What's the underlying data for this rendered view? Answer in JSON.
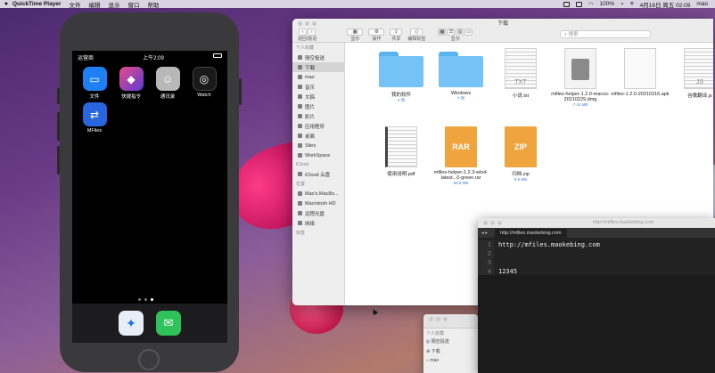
{
  "menubar": {
    "apple": "",
    "app_name": "QuickTime Player",
    "items": [
      "文件",
      "编辑",
      "显示",
      "窗口",
      "帮助"
    ],
    "battery": "100%",
    "datetime": "4月16日 周五 02:09",
    "user": "mao"
  },
  "phone": {
    "status_left": "运营商",
    "status_time": "上午2:09",
    "apps": [
      {
        "label": "文件",
        "color": "#1f7ff5",
        "glyph": "▭"
      },
      {
        "label": "快捷指令",
        "color": "#5b3bd6",
        "glyph": "◆"
      },
      {
        "label": "通讯录",
        "color": "#9a9a9a",
        "glyph": "☺"
      },
      {
        "label": "Watch",
        "color": "#111111",
        "glyph": "◎"
      },
      {
        "label": "MFiles",
        "color": "#2a65e0",
        "glyph": "⇄"
      }
    ],
    "dock": [
      {
        "name": "safari",
        "color": "#e8eef8",
        "glyph": "✦"
      },
      {
        "name": "messages",
        "color": "#30c25a",
        "glyph": "✉"
      }
    ]
  },
  "finder": {
    "title": "下载",
    "nav_label": "返回/前进",
    "toolbar": [
      "显示",
      "操作",
      "共享",
      "编辑标签",
      "显示"
    ],
    "search_placeholder": "搜索",
    "sidebar": [
      {
        "type": "header",
        "label": "个人收藏"
      },
      {
        "type": "item",
        "label": "隔空投送"
      },
      {
        "type": "item",
        "label": "下载",
        "selected": true
      },
      {
        "type": "item",
        "label": "mao"
      },
      {
        "type": "item",
        "label": "音乐"
      },
      {
        "type": "item",
        "label": "文稿"
      },
      {
        "type": "item",
        "label": "图片"
      },
      {
        "type": "item",
        "label": "影片"
      },
      {
        "type": "item",
        "label": "应用程序"
      },
      {
        "type": "item",
        "label": "桌面"
      },
      {
        "type": "item",
        "label": "Sites"
      },
      {
        "type": "item",
        "label": "WorkSpace"
      },
      {
        "type": "header",
        "label": "iCloud"
      },
      {
        "type": "item",
        "label": "iCloud 云盘"
      },
      {
        "type": "header",
        "label": "位置"
      },
      {
        "type": "item",
        "label": "Mao's MacBo..."
      },
      {
        "type": "item",
        "label": "Macintosh HD"
      },
      {
        "type": "item",
        "label": "远程光盘"
      },
      {
        "type": "item",
        "label": "网络"
      },
      {
        "type": "header",
        "label": "标签"
      }
    ],
    "files": [
      {
        "name": "我的软件",
        "sub": "4 项",
        "kind": "folder"
      },
      {
        "name": "Windows",
        "sub": "7 项",
        "kind": "folder"
      },
      {
        "name": "小说.txt",
        "sub": "",
        "kind": "doc",
        "badge": "TXT"
      },
      {
        "name": "mfiles-helper-1.2.0-macos-20210229.dmg",
        "sub": "7.44 MB",
        "kind": "doc",
        "badge": "DMG"
      },
      {
        "name": "mfiles-1.2.0-20210316.apk",
        "sub": "",
        "kind": "doc",
        "badge": ""
      },
      {
        "name": "谷歌翻译.js",
        "sub": "",
        "kind": "doc",
        "badge": "JS"
      },
      {
        "name": "使用说明.pdf",
        "sub": "",
        "kind": "lines",
        "badge": ""
      },
      {
        "name": "mfiles-helper-1.2.3-wind-latest...0-green.rar",
        "sub": "56.9 MB",
        "kind": "zip",
        "badge": "RAR"
      },
      {
        "name": "归档.zip",
        "sub": "8.5 MB",
        "kind": "zip",
        "badge": "ZIP"
      }
    ]
  },
  "editor": {
    "title": "http://mfiles.maokebing.com",
    "tab": "http://mfiles.maokebing.com",
    "lines": [
      "http://mfiles.maokebing.com",
      "",
      "",
      "12345",
      ""
    ],
    "line_numbers": [
      "1",
      "2",
      "3",
      "4",
      "5"
    ]
  },
  "small_finder": {
    "header": "个人收藏",
    "items": [
      "隔空投送",
      "下载",
      "mao"
    ]
  }
}
